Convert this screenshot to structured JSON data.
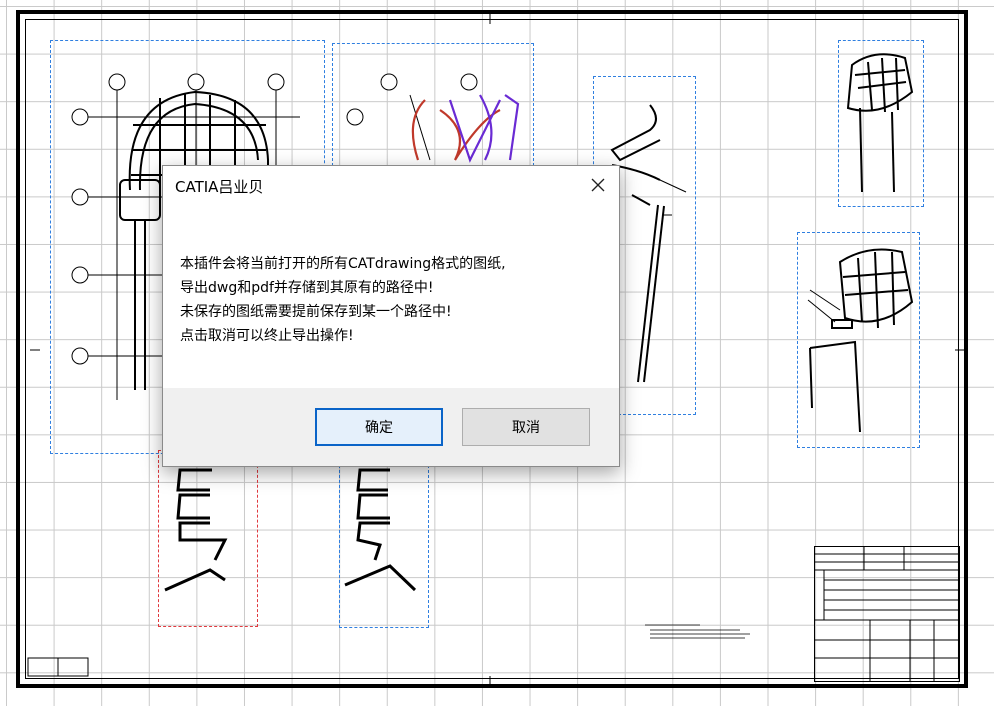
{
  "dialog": {
    "title": "CATIA吕业贝",
    "close_icon": "close-icon",
    "message_lines": [
      "本插件会将当前打开的所有CATdrawing格式的图纸,",
      "导出dwg和pdf并存储到其原有的路径中!",
      "未保存的图纸需要提前保存到某一个路径中!",
      "点击取消可以终止导出操作!"
    ],
    "ok_label": "确定",
    "cancel_label": "取消"
  },
  "colors": {
    "view_frame": "#2f7fe0",
    "view_frame_active": "#e0393e",
    "dialog_primary_border": "#0a64c8",
    "section_red": "#c0392b",
    "section_purple": "#6a2bd4"
  }
}
